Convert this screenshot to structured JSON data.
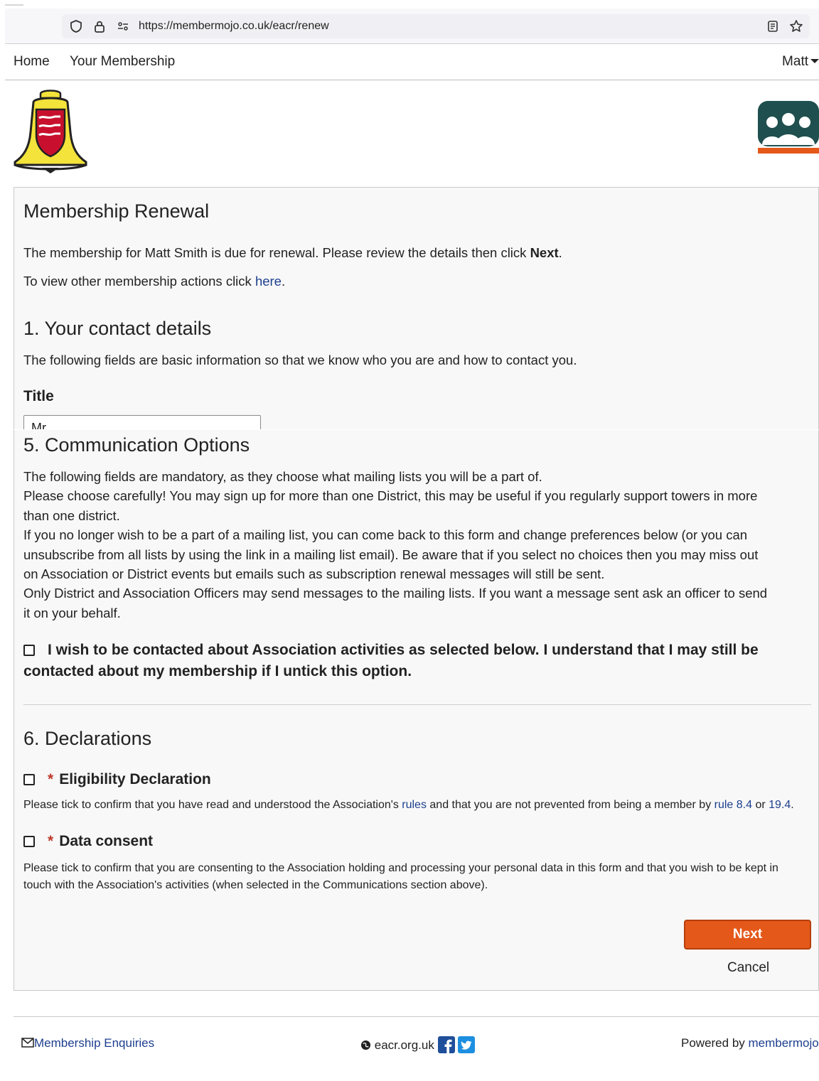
{
  "browser": {
    "url": "https://membermojo.co.uk/eacr/renew"
  },
  "nav": {
    "home": "Home",
    "membership": "Your Membership",
    "user": "Matt"
  },
  "renewal": {
    "title": "Membership Renewal",
    "intro_prefix": "The membership for Matt Smith is due for renewal. Please review the details then click ",
    "intro_bold": "Next",
    "intro_suffix": ".",
    "other_prefix": "To view other membership actions click ",
    "other_link": "here",
    "other_suffix": "."
  },
  "contact": {
    "heading": "1. Your contact details",
    "description": "The following fields are basic information so that we know who you are and how to contact you.",
    "title_label": "Title",
    "title_value": "Mr"
  },
  "communication": {
    "heading": "5. Communication Options",
    "lines": [
      "The following fields are mandatory, as they choose what mailing lists you will be a part of.",
      "Please choose carefully! You may sign up for more than one District, this may be useful if you regularly support towers in more",
      "than one district.",
      "If you no longer wish to be a part of a mailing list, you can come back to this form and change preferences below (or you can",
      "unsubscribe from all lists by using the link in a mailing list email). Be aware that if you select no choices then you may miss out",
      "on Association or District events but emails such as subscription renewal messages will still be sent.",
      "Only District and Association Officers may send messages to the mailing lists. If you want a message sent ask an officer to send",
      "it on your behalf."
    ],
    "opt_in_line1": "I wish to be contacted about Association activities as selected below. I understand that I may still be",
    "opt_in_line2": "contacted about my membership if I untick this option."
  },
  "declarations": {
    "heading": "6. Declarations",
    "eligibility": {
      "label": "Eligibility Declaration",
      "text_prefix": "Please tick to confirm that you have read and understood the Association's ",
      "rules_link": "rules",
      "text_mid": " and that you are not prevented from being a member by ",
      "rule_link": "rule 8.4",
      "text_or": " or ",
      "rule2_link": "19.4",
      "text_suffix": "."
    },
    "consent": {
      "label": "Data consent",
      "line1": "Please tick to confirm that you are consenting to the Association holding and processing your personal data in this form and that you wish to be kept in",
      "line2": "touch with the Association's activities (when selected in the Communications section above)."
    },
    "required_mark": "*"
  },
  "actions": {
    "next": "Next",
    "cancel": "Cancel"
  },
  "footer": {
    "enquiries": "Membership Enquiries",
    "website": "eacr.org.uk",
    "powered_prefix": "Powered by ",
    "powered_link": "membermojo"
  },
  "colors": {
    "accent": "#e4581a",
    "link": "#1d3f8f",
    "bell_yellow": "#f3e33a",
    "shield_red": "#c8102e",
    "members_teal": "#1f4f4f"
  }
}
